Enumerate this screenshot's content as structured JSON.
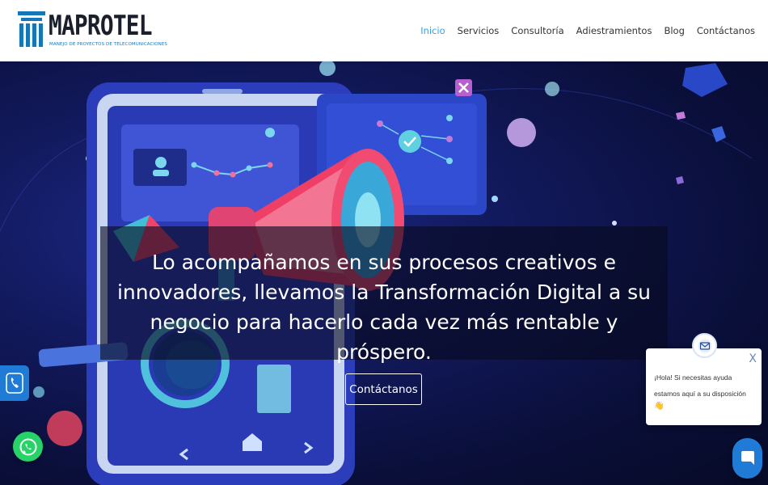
{
  "brand": {
    "name": "MAPROTEL",
    "tagline": "MANEJO DE PROYECTOS DE TELECOMUNICACIONES",
    "primary_color": "#1478b8"
  },
  "nav": {
    "items": [
      {
        "label": "Inicio",
        "active": true
      },
      {
        "label": "Servicios"
      },
      {
        "label": "Consultoría"
      },
      {
        "label": "Adiestramientos"
      },
      {
        "label": "Blog"
      },
      {
        "label": "Contáctanos"
      }
    ],
    "active_color": "#2ea3f2"
  },
  "hero": {
    "headline_lines": [
      "Lo acompañamos en sus procesos creativos e",
      "innovadores, llevamos la Transformación Digital a su",
      "negocio para hacerlo cada vez más rentable y próspero."
    ],
    "cta_label": "Contáctanos"
  },
  "widgets": {
    "phone_icon": "phone-icon",
    "whatsapp_icon": "whatsapp-icon",
    "whatsapp_color": "#25d366",
    "chat": {
      "line1": "¡Hola! Si necesitas ayuda",
      "line2": "estamos aquí a su disposición",
      "emoji": "👋",
      "close_label": "X",
      "accent_color": "#1f7bd6"
    }
  }
}
